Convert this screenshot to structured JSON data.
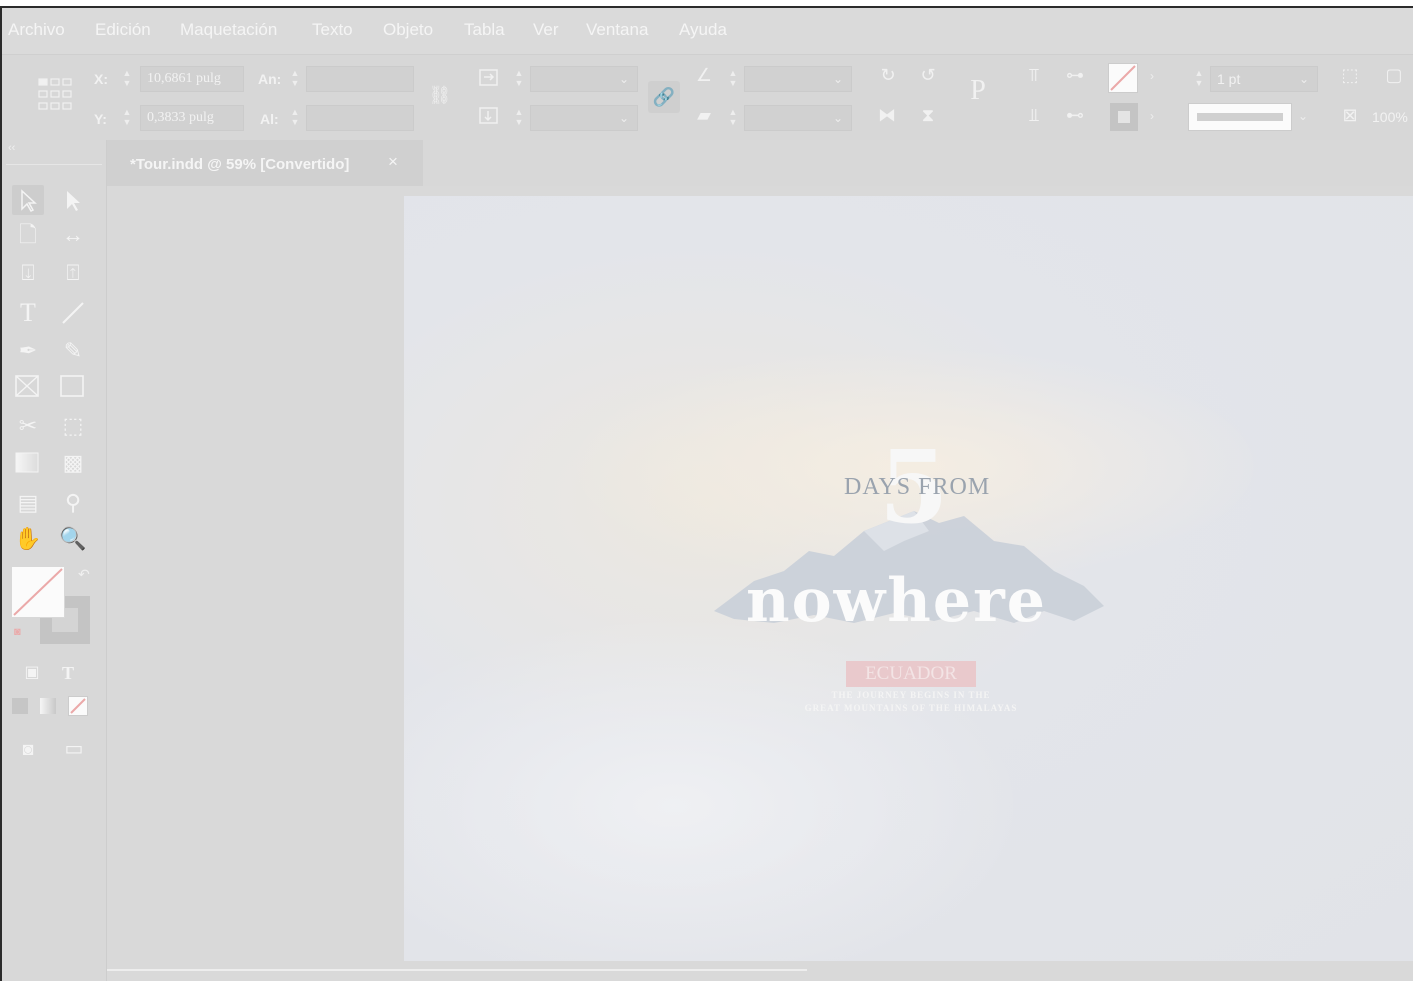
{
  "menu": [
    "Archivo",
    "Edición",
    "Maquetación",
    "Texto",
    "Objeto",
    "Tabla",
    "Ver",
    "Ventana",
    "Ayuda"
  ],
  "control": {
    "x_label": "X:",
    "x_value": "10,6861 pulg",
    "y_label": "Y:",
    "y_value": "0,3833 pulg",
    "w_label": "An:",
    "h_label": "Al:",
    "stroke_weight": "1 pt",
    "scale": "100%"
  },
  "document": {
    "tab_title": "*Tour.indd @ 59% [Convertido]",
    "close_symbol": "×"
  },
  "artwork": {
    "number": "5",
    "days_from": "DAYS FROM",
    "headline": "nowhere",
    "ribbon": "ECUADOR",
    "line1": "THE JOURNEY BEGINS IN THE",
    "line2": "GREAT MOUNTAINS OF THE HIMALAYAS"
  },
  "colors": {
    "accent_ribbon": "#e9c9cc",
    "ui_bg": "#d8d8d8"
  },
  "icons": [
    "selection-tool",
    "direct-selection-tool",
    "page-tool",
    "gap-tool",
    "content-collector-tool",
    "content-placer-tool",
    "type-tool",
    "line-tool",
    "pen-tool",
    "pencil-tool",
    "rectangle-frame-tool",
    "rectangle-tool",
    "scissors-tool",
    "free-transform-tool",
    "gradient-swatch-tool",
    "gradient-feather-tool",
    "note-tool",
    "eyedropper-tool",
    "hand-tool",
    "zoom-tool"
  ]
}
